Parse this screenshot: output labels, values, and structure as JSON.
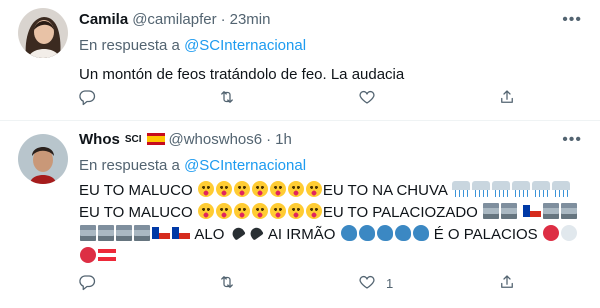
{
  "tweets": [
    {
      "name": "Camila",
      "handle": "@camilapfer",
      "separator": "·",
      "time": "23min",
      "reply_prefix": "En respuesta a",
      "reply_to": "@SCInternacional",
      "text": "Un montón de feos tratándolo de feo. La audacia",
      "counts": {
        "replies": "",
        "retweets": "",
        "likes": "",
        "share": ""
      }
    },
    {
      "name": "Whos",
      "badge": "SCI",
      "handle": "@whoswhos6",
      "separator": "·",
      "time": "1h",
      "reply_prefix": "En respuesta a",
      "reply_to": "@SCInternacional",
      "text_parts": [
        "EU TO MALUCO",
        "EU TO NA CHUVA",
        "EU TO MALUCO",
        "EU TO PALACIOZADO",
        "ALO",
        "AI IRMÃO",
        "É O PALACIOS"
      ],
      "counts": {
        "replies": "",
        "retweets": "",
        "likes": "1",
        "share": ""
      }
    }
  ],
  "icons": {
    "reply": "reply-icon",
    "retweet": "retweet-icon",
    "like": "heart-icon",
    "share": "share-icon",
    "more": "more-icon"
  },
  "colors": {
    "link": "#1d9bf0",
    "secondary": "#536471",
    "text": "#0f1419"
  }
}
